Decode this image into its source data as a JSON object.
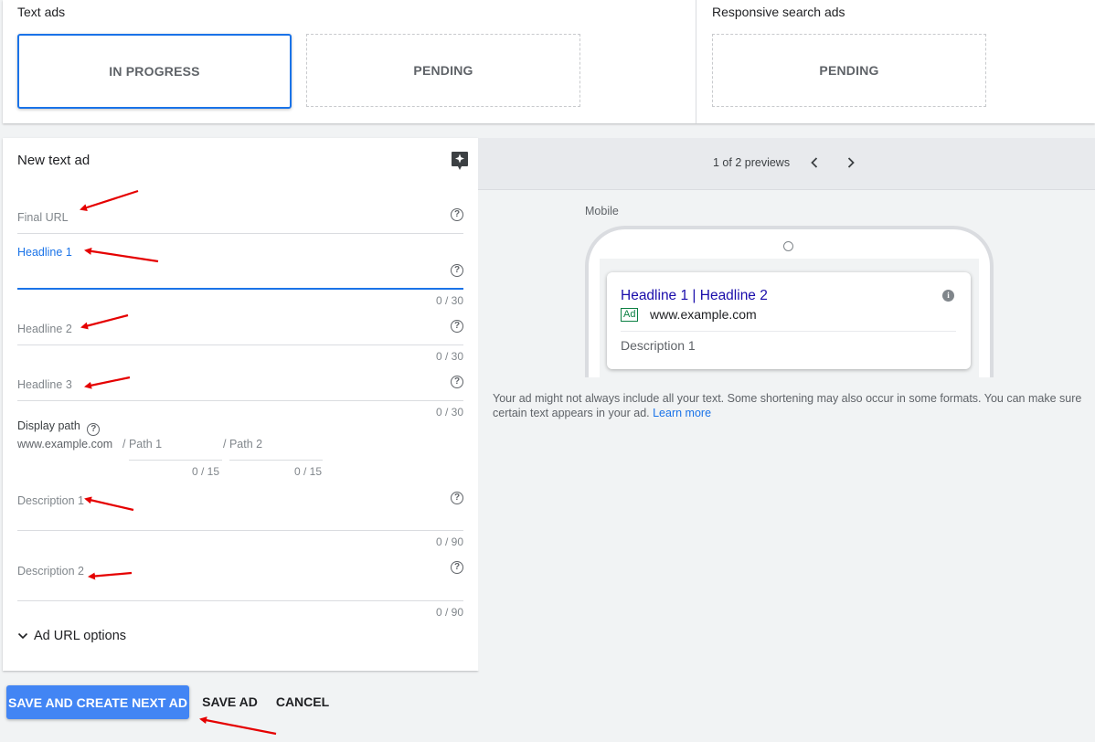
{
  "top": {
    "text_ads_title": "Text ads",
    "text_ads_in_progress": "IN PROGRESS",
    "text_ads_pending": "PENDING",
    "rsa_title": "Responsive search ads",
    "rsa_pending": "PENDING"
  },
  "editor": {
    "title": "New text ad",
    "final_url_label": "Final URL",
    "headline1_label": "Headline 1",
    "headline1_counter": "0 / 30",
    "headline2_label": "Headline 2",
    "headline2_counter": "0 / 30",
    "headline3_label": "Headline 3",
    "headline3_counter": "0 / 30",
    "display_path_label": "Display path",
    "display_path_domain": "www.example.com",
    "path1_label": "/ Path 1",
    "path1_counter": "0 / 15",
    "path2_label": "/ Path 2",
    "path2_counter": "0 / 15",
    "description1_label": "Description 1",
    "description1_counter": "0 / 90",
    "description2_label": "Description 2",
    "description2_counter": "0 / 90",
    "url_options_label": "Ad URL options"
  },
  "preview": {
    "count_label": "1 of 2 previews",
    "device_label": "Mobile",
    "ad_headline": "Headline 1 | Headline 2",
    "ad_badge": "Ad",
    "ad_url": "www.example.com",
    "ad_description": "Description 1",
    "note": "Your ad might not always include all your text. Some shortening may also occur in some formats. You can make sure certain text appears in your ad.",
    "learn_more": "Learn more"
  },
  "actions": {
    "save_next": "SAVE AND CREATE NEXT AD",
    "save": "SAVE AD",
    "cancel": "CANCEL"
  },
  "icons": {
    "help": "help-circle-icon",
    "spark": "ad-spark-icon",
    "prev": "chevron-left-icon",
    "next": "chevron-right-icon",
    "expand": "chevron-down-icon",
    "info": "info-icon"
  },
  "colors": {
    "accent": "#1a73e8",
    "primary_button": "#4285f4",
    "ad_headline": "#1a0dab",
    "ad_badge": "#0b8043",
    "annotation": "#e50000"
  }
}
